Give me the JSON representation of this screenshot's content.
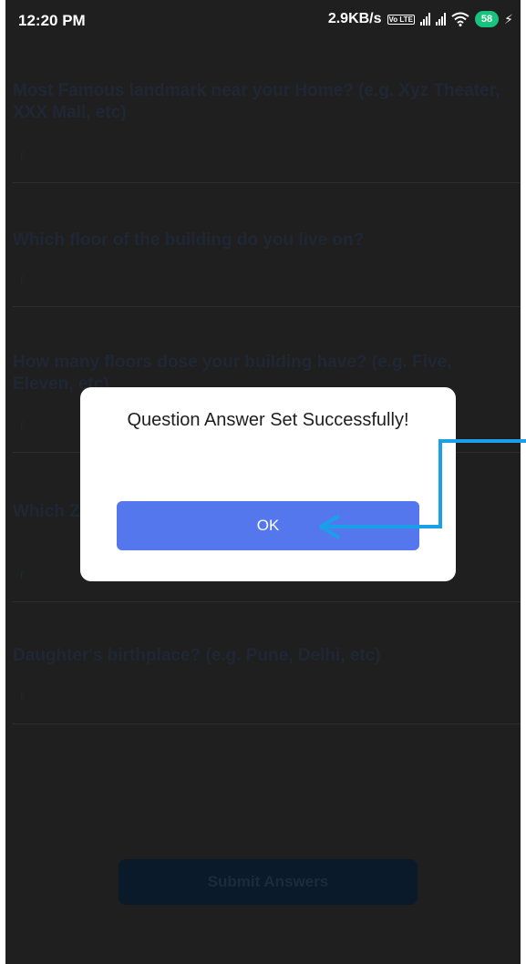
{
  "status_bar": {
    "time": "12:20 PM",
    "network_speed": "2.9KB/s",
    "volte": "Vo LTE",
    "battery": "58",
    "charging_icon": "lightning-icon",
    "wifi_icon": "wifi-icon"
  },
  "questions": [
    {
      "question": "Most Famous landmark near your Home? (e.g. Xyz Theater, XXX Mall, etc)",
      "answer": "r"
    },
    {
      "question": "Which floor of the building do you live on?",
      "answer": "r"
    },
    {
      "question": "How many floors dose your building have? (e.g. Five, Eleven, etc)",
      "answer": "r"
    },
    {
      "question": "Which Zaf etc.)",
      "answer": "r"
    },
    {
      "question": "Daughter's birthplace? (e.g. Pune, Delhi, etc)",
      "answer": "r"
    }
  ],
  "submit_label": "Submit Answers",
  "dialog": {
    "message": "Question Answer Set Successfully!",
    "ok_label": "OK"
  },
  "colors": {
    "overlay_background": "#1f1f1f",
    "ok_button": "#5577ee",
    "annotation_arrow": "#1aa0e8",
    "battery": "#19c37d"
  }
}
